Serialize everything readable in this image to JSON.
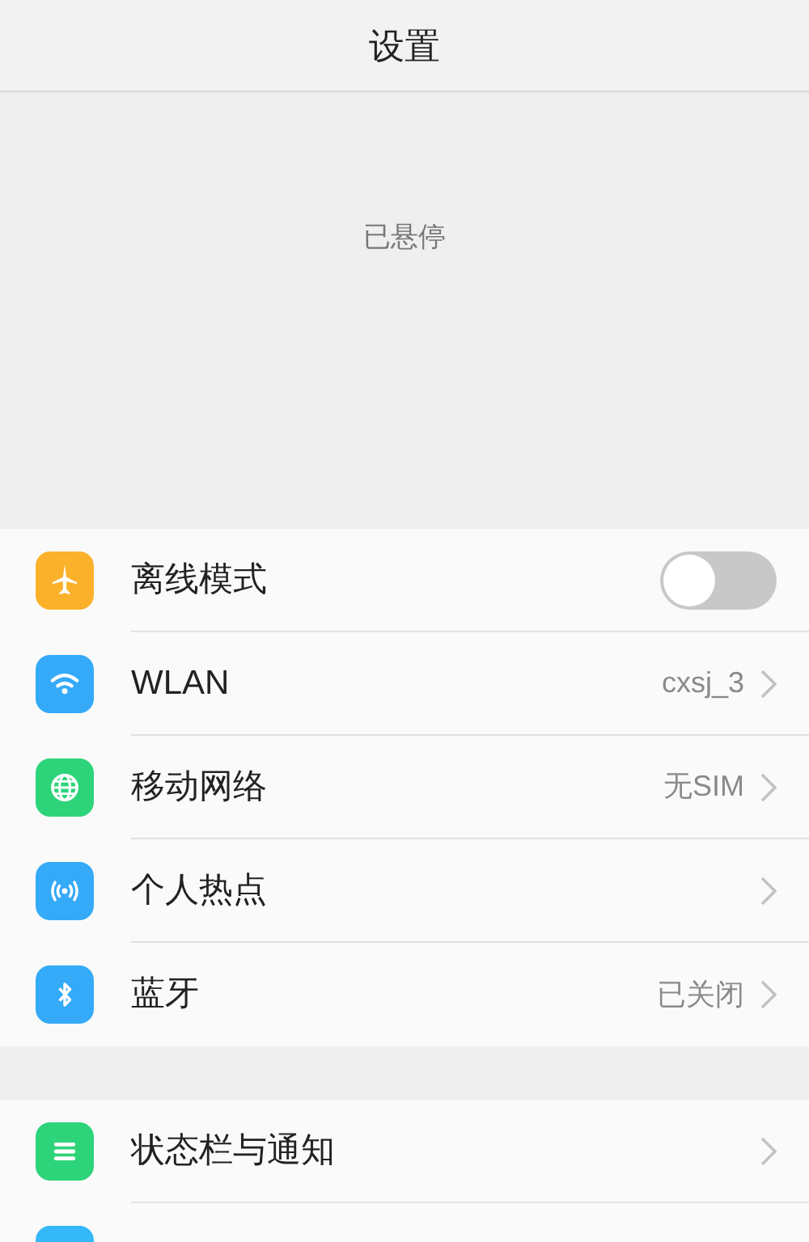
{
  "window": {
    "title": "设置"
  },
  "placeholder_text": "已悬停",
  "groups": [
    {
      "items": [
        {
          "kind": "toggle",
          "label": "离线模式",
          "on": false
        },
        {
          "kind": "link",
          "label": "WLAN",
          "value": "cxsj_3"
        },
        {
          "kind": "link",
          "label": "移动网络",
          "value": "无SIM"
        },
        {
          "kind": "link",
          "label": "个人热点"
        },
        {
          "kind": "link",
          "label": "蓝牙",
          "value": "已关闭"
        }
      ]
    },
    {
      "items": [
        {
          "kind": "link",
          "label": "状态栏与通知"
        },
        {
          "kind": "cut"
        }
      ]
    }
  ]
}
